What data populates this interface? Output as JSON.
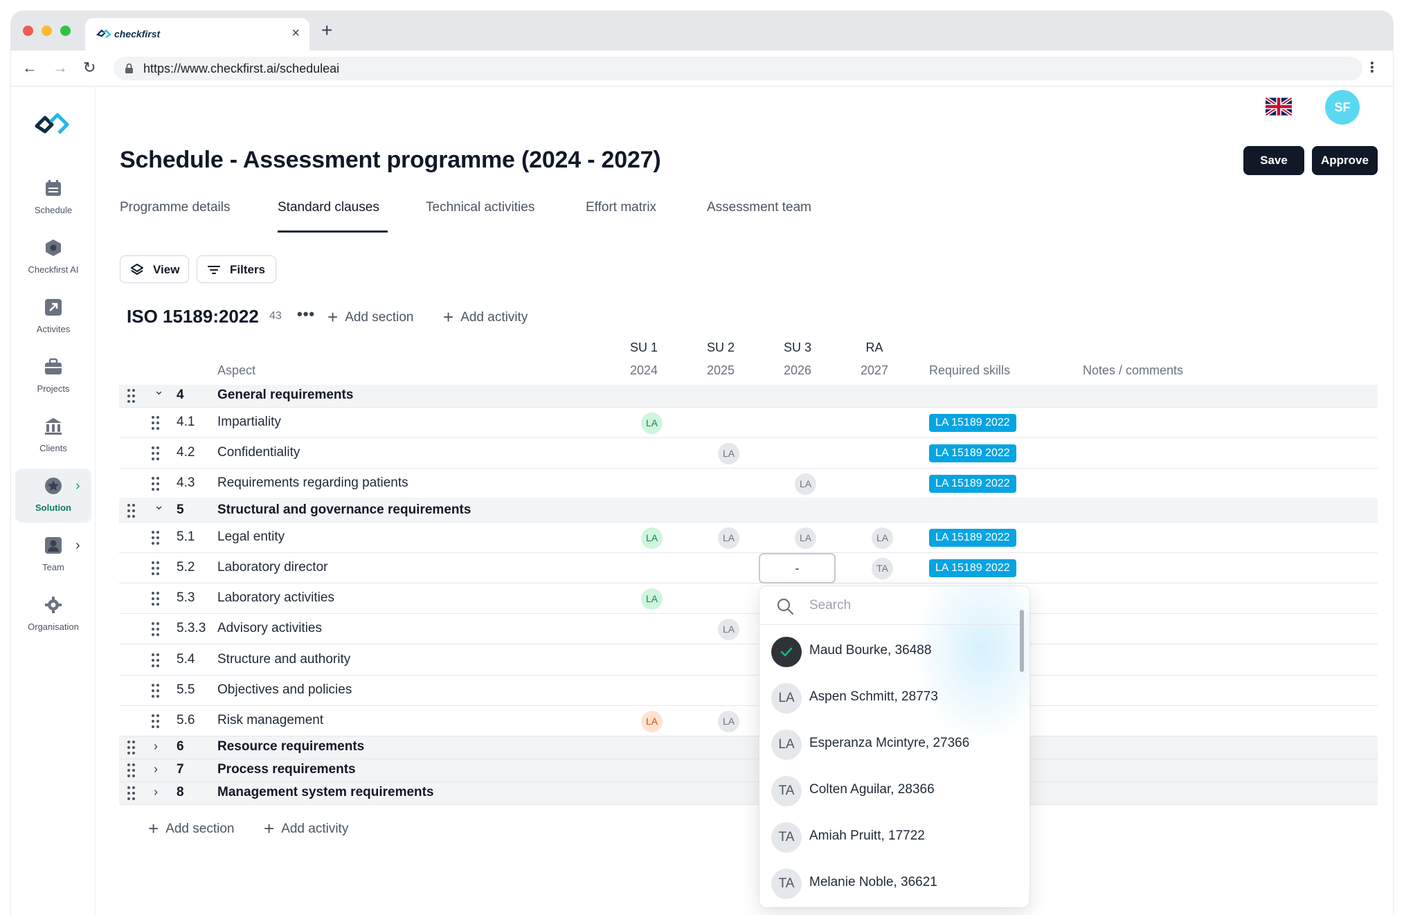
{
  "browser": {
    "tab_title": "checkfirst",
    "url": "https://www.checkfirst.ai/scheduleai"
  },
  "sidebar": {
    "items": [
      {
        "label": "Schedule",
        "icon": "calendar-icon"
      },
      {
        "label": "Checkfirst AI",
        "icon": "ai-hexagon-icon"
      },
      {
        "label": "Activites",
        "icon": "arrow-up-right-icon"
      },
      {
        "label": "Projects",
        "icon": "briefcase-icon"
      },
      {
        "label": "Clients",
        "icon": "bank-icon"
      },
      {
        "label": "Solution",
        "icon": "star-badge-icon",
        "active": true
      },
      {
        "label": "Team",
        "icon": "user-icon"
      },
      {
        "label": "Organisation",
        "icon": "gear-icon"
      }
    ]
  },
  "header": {
    "avatar_initials": "SF",
    "title": "Schedule - Assessment programme (2024 - 2027)",
    "save_label": "Save",
    "approve_label": "Approve"
  },
  "tabs": [
    "Programme details",
    "Standard clauses",
    "Technical activities",
    "Effort matrix",
    "Assessment team"
  ],
  "active_tab": "Standard clauses",
  "toolbar": {
    "view_label": "View",
    "filters_label": "Filters"
  },
  "standard": {
    "name": "ISO 15189:2022",
    "count": "43",
    "add_section": "Add section",
    "add_activity": "Add activity"
  },
  "columns": {
    "aspect": "Aspect",
    "audits": [
      {
        "label": "SU 1",
        "year": "2024"
      },
      {
        "label": "SU 2",
        "year": "2025"
      },
      {
        "label": "SU 3",
        "year": "2026"
      },
      {
        "label": "RA",
        "year": "2027"
      }
    ],
    "required_skills": "Required skills",
    "notes": "Notes / comments"
  },
  "rows": [
    {
      "num": "4",
      "text": "General requirements",
      "section": true,
      "expanded": true
    },
    {
      "num": "4.1",
      "text": "Impartiality",
      "cells": [
        "LA",
        "",
        "",
        ""
      ],
      "skill": "LA 15189 2022"
    },
    {
      "num": "4.2",
      "text": "Confidentiality",
      "cells": [
        "",
        "LA",
        "",
        ""
      ],
      "skill": "LA 15189 2022"
    },
    {
      "num": "4.3",
      "text": "Requirements regarding patients",
      "cells": [
        "",
        "",
        "LA",
        ""
      ],
      "skill": "LA 15189 2022"
    },
    {
      "num": "5",
      "text": "Structural and governance requirements",
      "section": true,
      "expanded": true
    },
    {
      "num": "5.1",
      "text": "Legal entity",
      "cells": [
        "LA",
        "LA",
        "LA",
        "LA"
      ],
      "skill": "LA 15189 2022"
    },
    {
      "num": "5.2",
      "text": "Laboratory director",
      "cells": [
        "",
        "",
        "-",
        "TA"
      ],
      "skill": "LA 15189 2022"
    },
    {
      "num": "5.3",
      "text": "Laboratory activities",
      "cells": [
        "LA",
        "",
        "",
        ""
      ]
    },
    {
      "num": "5.3.3",
      "text": "Advisory activities",
      "cells": [
        "",
        "LA",
        "",
        ""
      ]
    },
    {
      "num": "5.4",
      "text": "Structure and authority",
      "cells": [
        "",
        "",
        "",
        ""
      ]
    },
    {
      "num": "5.5",
      "text": "Objectives and policies",
      "cells": [
        "",
        "",
        "",
        ""
      ]
    },
    {
      "num": "5.6",
      "text": "Risk management",
      "cells": [
        "LA",
        "LA",
        "",
        ""
      ]
    },
    {
      "num": "6",
      "text": "Resource requirements",
      "section": true,
      "expanded": false
    },
    {
      "num": "7",
      "text": "Process requirements",
      "section": true,
      "expanded": false
    },
    {
      "num": "8",
      "text": "Management system requirements",
      "section": true,
      "expanded": false
    }
  ],
  "footer": {
    "add_section": "Add section",
    "add_activity": "Add activity"
  },
  "dropdown": {
    "search_placeholder": "Search",
    "options": [
      {
        "initials": "",
        "name": "Maud Bourke, 36488",
        "checked": true
      },
      {
        "initials": "LA",
        "name": "Aspen Schmitt, 28773"
      },
      {
        "initials": "LA",
        "name": "Esperanza Mcintyre, 27366"
      },
      {
        "initials": "TA",
        "name": "Colten Aguilar, 28366"
      },
      {
        "initials": "TA",
        "name": "Amiah Pruitt, 17722"
      },
      {
        "initials": "TA",
        "name": "Melanie Noble, 36621"
      }
    ]
  },
  "colors": {
    "skill_badge": "#06a4e2",
    "lead_badge_bg": "#cff5dd",
    "lead_badge_text": "#0c8a4d",
    "warn_badge_bg": "#fde3d0",
    "warn_badge_text": "#e1480c",
    "avatar_bg": "#5ad8f2",
    "button_dark": "#111827"
  }
}
